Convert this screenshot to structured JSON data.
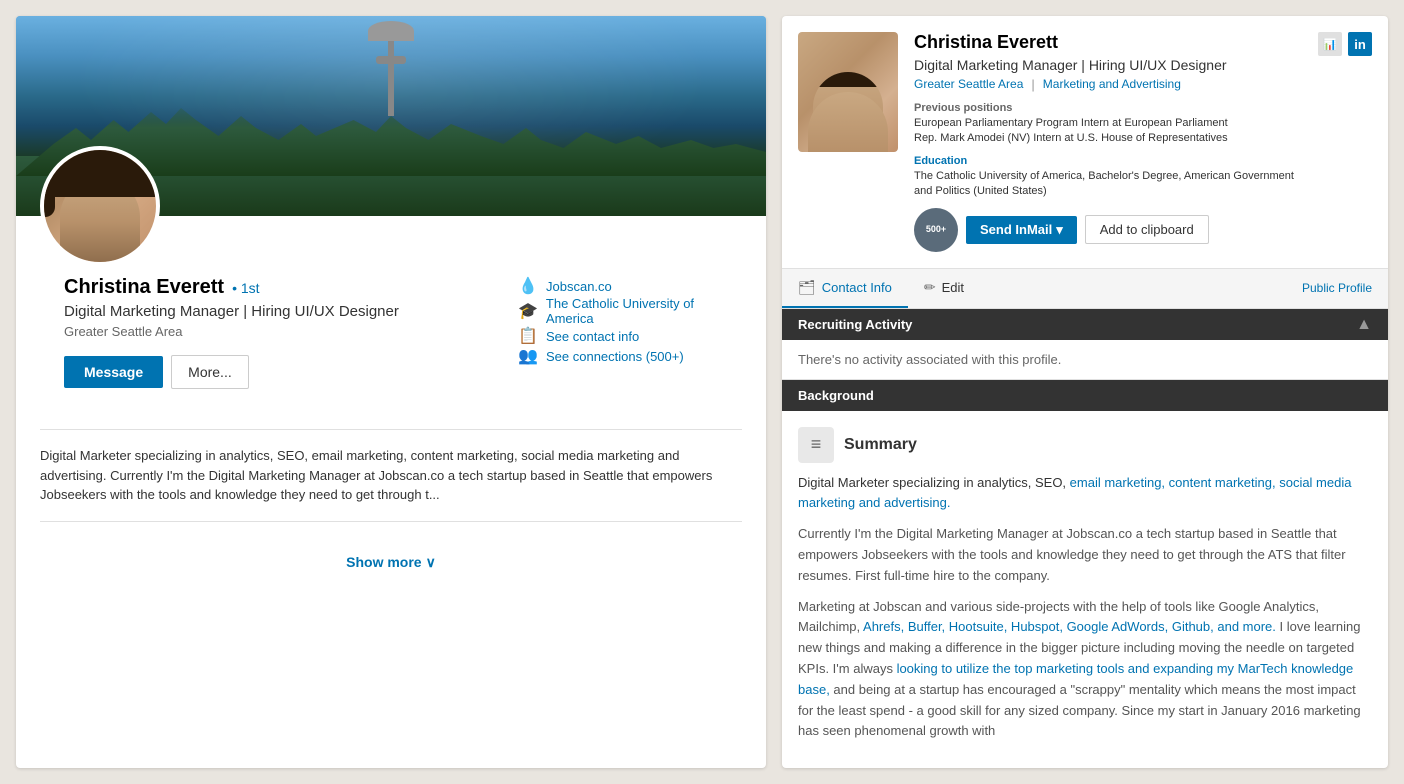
{
  "leftPanel": {
    "profileName": "Christina Everett",
    "degreeBadge": "• 1st",
    "profileTitle": "Digital Marketing Manager | Hiring UI/UX Designer",
    "profileLocation": "Greater Seattle Area",
    "buttons": {
      "message": "Message",
      "more": "More..."
    },
    "rightInfo": [
      {
        "icon": "💧",
        "text": "Jobscan.co"
      },
      {
        "icon": "🎓",
        "text": "The Catholic University of America"
      },
      {
        "icon": "📋",
        "text": "See contact info"
      },
      {
        "icon": "👥",
        "text": "See connections (500+)"
      }
    ],
    "summary": "Digital Marketer specializing in analytics, SEO, email marketing, content marketing, social media marketing and advertising. Currently I'm the Digital Marketing Manager at Jobscan.co a tech startup based in Seattle that empowers Jobseekers with the tools and knowledge they need to get through t...",
    "showMore": "Show more"
  },
  "rightPanel": {
    "candidate": {
      "name": "Christina Everett",
      "title": "Digital Marketing Manager | Hiring UI/UX Designer",
      "location": "Greater Seattle Area",
      "locationSeparator": "|",
      "industry": "Marketing and Advertising",
      "prevPositionsLabel": "Previous positions",
      "prevPositions": [
        "European Parliamentary Program Intern at European Parliament",
        "Rep. Mark Amodei (NV) Intern at U.S. House of Representatives"
      ],
      "educationLabel": "Education",
      "educationText": "The Catholic University of America, Bachelor's Degree, American Government and Politics (United States)",
      "connectionsBadge": "500+"
    },
    "headerIcons": [
      {
        "label": "📊",
        "name": "chart-icon"
      },
      {
        "label": "in",
        "name": "linkedin-icon",
        "isLinkedIn": true
      }
    ],
    "buttons": {
      "sendInmail": "Send InMail",
      "addToClipboard": "Add to clipboard"
    },
    "tabs": {
      "contactInfo": "Contact Info",
      "edit": "Edit",
      "publicProfile": "Public Profile"
    },
    "recruitingActivity": {
      "sectionTitle": "Recruiting Activity",
      "noActivity": "There's no activity associated with this profile."
    },
    "background": {
      "sectionTitle": "Background",
      "summaryTitle": "Summary",
      "summaryParagraph1Link": "email marketing, content marketing, social media marketing and advertising.",
      "summaryParagraph1": "Digital Marketer specializing in analytics, SEO, email marketing, content marketing, social media marketing and advertising.",
      "summaryParagraph2": "Currently I'm the Digital Marketing Manager at Jobscan.co a tech startup based in Seattle that empowers Jobseekers with the tools and knowledge they need to get through the ATS that filter resumes. First full-time hire to the company.",
      "summaryParagraph3": "Marketing at Jobscan and various side-projects with the help of tools like Google Analytics, Mailchimp, Ahrefs, Buffer, Hootsuite, Hubspot, Google AdWords, Github, and more. I love learning new things and making a difference in the bigger picture including moving the needle on targeted KPIs. I'm always looking to utilize the top marketing tools and expanding my MarTech knowledge base, and being at a startup has encouraged a \"scrappy\" mentality which means the most impact for the least spend - a good skill for any sized company. Since my start in January 2016 marketing has seen phenomenal growth with"
    }
  }
}
